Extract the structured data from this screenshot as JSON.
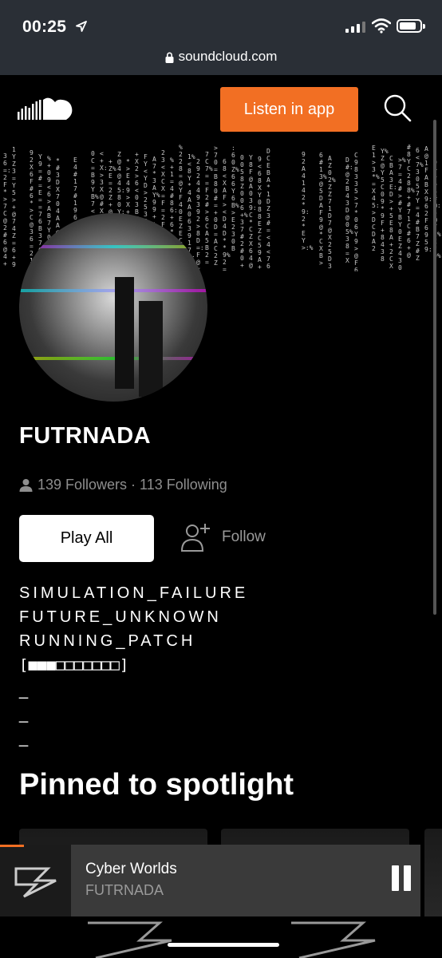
{
  "status_bar": {
    "time": "00:25",
    "url": "soundcloud.com"
  },
  "header": {
    "listen_label": "Listen in app"
  },
  "profile": {
    "name": "FUTRNADA",
    "stats": "139 Followers · 113 Following",
    "play_all_label": "Play All",
    "follow_label": "Follow",
    "bio_lines": [
      "SIMULATION_FAILURE",
      "FUTURE_UNKNOWN",
      "RUNNING_PATCH",
      "[■■■□□□□□□□]"
    ],
    "dash_lines": [
      "_",
      "_",
      "_"
    ]
  },
  "section": {
    "pinned_title": "Pinned to spotlight"
  },
  "player": {
    "track": "Cyber Worlds",
    "artist": "FUTRNADA"
  },
  "icons": [
    "location-arrow-icon",
    "signal-icon",
    "wifi-icon",
    "battery-icon",
    "lock-icon",
    "soundcloud-logo-icon",
    "search-icon",
    "user-icon",
    "follow-user-icon",
    "pause-icon"
  ],
  "colors": {
    "accent": "#f26f23",
    "background": "#000000",
    "muted": "#8e8e8e",
    "player_bg": "#3a3a3a"
  }
}
